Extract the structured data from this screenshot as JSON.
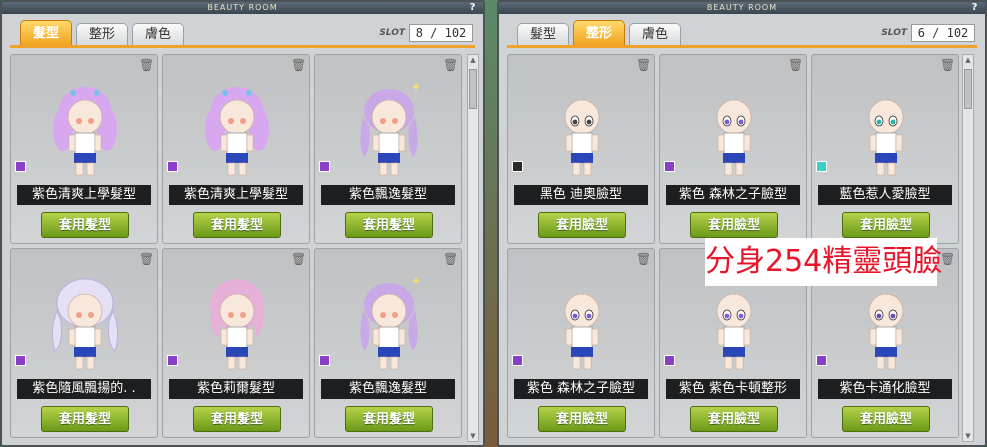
{
  "left": {
    "title": "BEAUTY ROOM",
    "help": "?",
    "tabs": [
      "髮型",
      "整形",
      "膚色"
    ],
    "active": 0,
    "slot_label": "SLOT",
    "slot": "8 / 102",
    "items": [
      {
        "name": "紫色清爽上學髮型",
        "swatch": "#8a3fc8",
        "hair": "#d7a8f0",
        "style": "twin"
      },
      {
        "name": "紫色清爽上學髮型",
        "swatch": "#8a3fc8",
        "hair": "#d7a8f0",
        "style": "twin"
      },
      {
        "name": "紫色飄逸髮型",
        "swatch": "#8a3fc8",
        "hair": "#c9a8e8",
        "style": "long"
      },
      {
        "name": "紫色隨風飄揚的. .",
        "swatch": "#8a3fc8",
        "hair": "#e6e0f6",
        "style": "flow"
      },
      {
        "name": "紫色莉爾髮型",
        "swatch": "#8a3fc8",
        "hair": "#e6b0d8",
        "style": "bob"
      },
      {
        "name": "紫色飄逸髮型",
        "swatch": "#8a3fc8",
        "hair": "#c9a8e8",
        "style": "long"
      }
    ],
    "button_label": "套用髮型"
  },
  "right": {
    "title": "BEAUTY ROOM",
    "help": "?",
    "tabs": [
      "髮型",
      "整形",
      "膚色"
    ],
    "active": 1,
    "slot_label": "SLOT",
    "slot": "6 / 102",
    "items": [
      {
        "name": "黑色 迪奧臉型",
        "swatch": "#2a2a2a",
        "eye": "#444444"
      },
      {
        "name": "紫色 森林之子臉型",
        "swatch": "#8a3fc8",
        "eye": "#7a5ad0"
      },
      {
        "name": "藍色惹人愛臉型",
        "swatch": "#3ad0c0",
        "eye": "#2ab0a8"
      },
      {
        "name": "紫色 森林之子臉型",
        "swatch": "#8a3fc8",
        "eye": "#7a5ad0"
      },
      {
        "name": "紫色 紫色卡頓整形",
        "swatch": "#8a3fc8",
        "eye": "#8a5ad8"
      },
      {
        "name": "紫色卡通化臉型",
        "swatch": "#8a3fc8",
        "eye": "#6a4ab0"
      }
    ],
    "button_label": "套用臉型"
  },
  "annotation": "分身254精靈頭臉",
  "icons": {
    "trash": "trash-icon",
    "help": "help-icon"
  }
}
